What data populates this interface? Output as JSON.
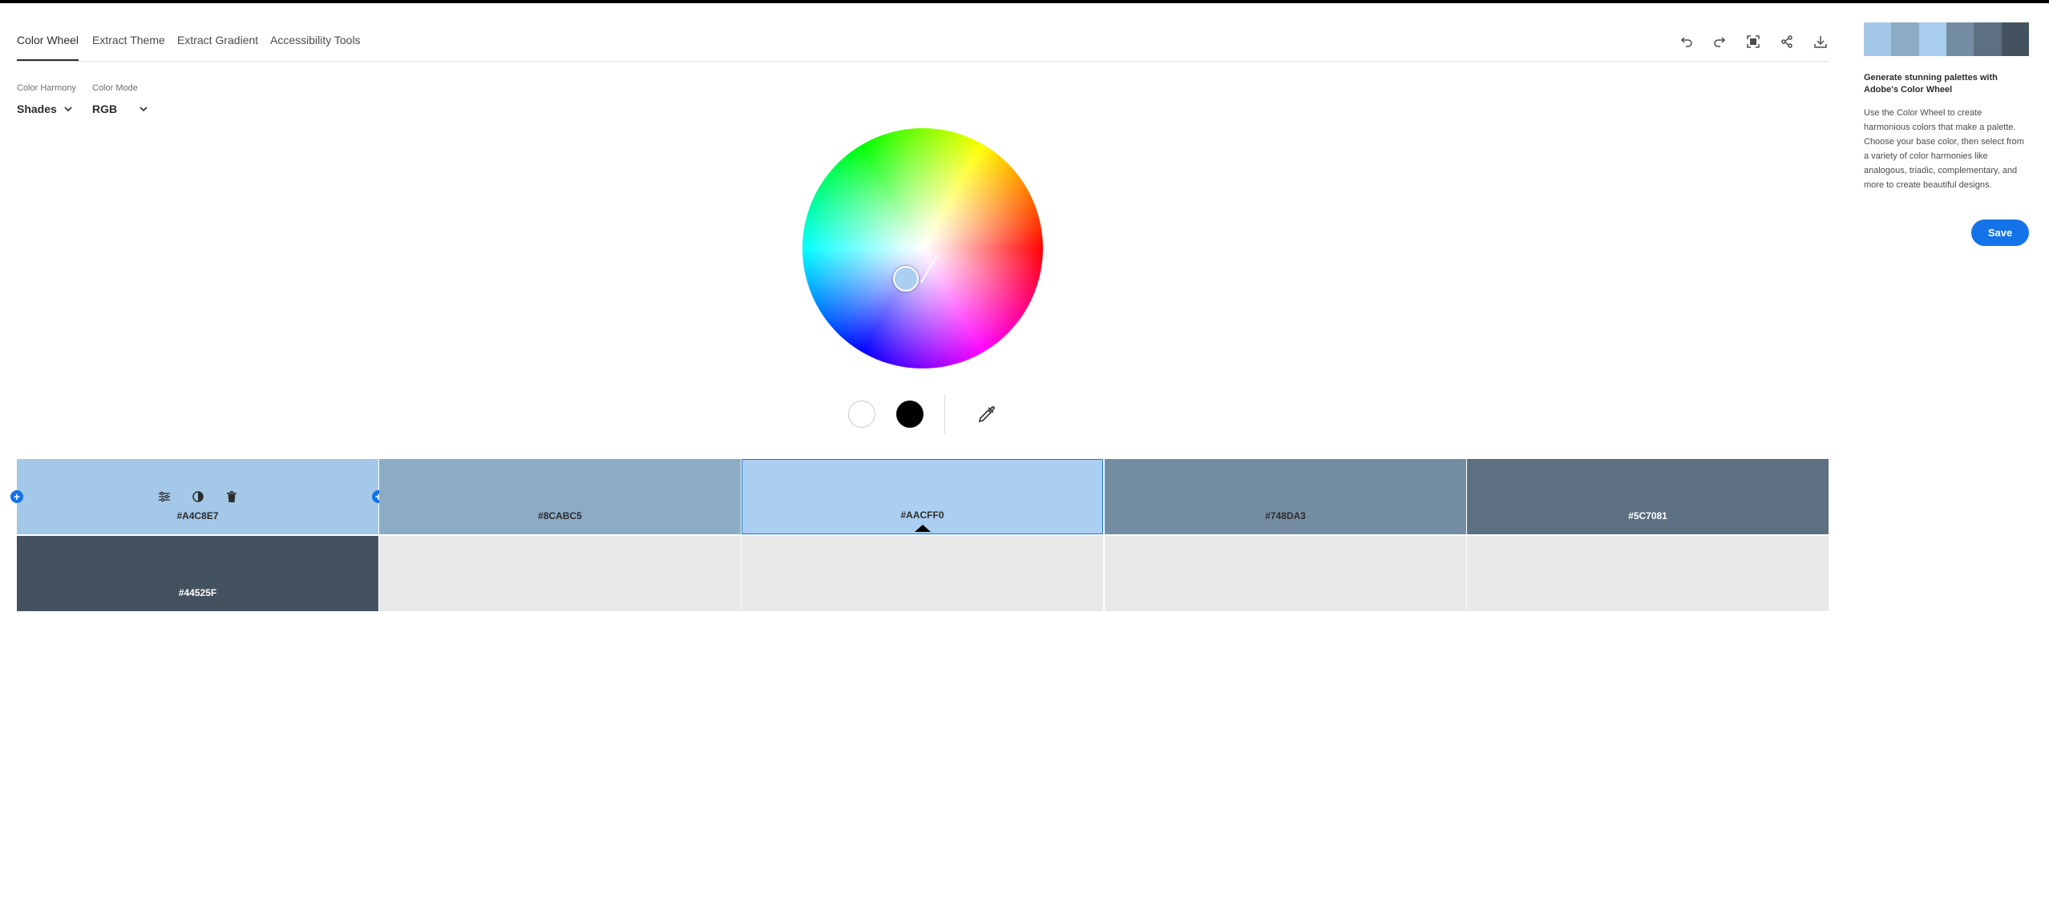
{
  "tabs": [
    {
      "label": "Color Wheel",
      "active": true
    },
    {
      "label": "Extract Theme"
    },
    {
      "label": "Extract Gradient"
    },
    {
      "label": "Accessibility Tools"
    }
  ],
  "toolbar": {
    "icons": [
      "undo-icon",
      "redo-icon",
      "fullscreen-icon",
      "share-icon",
      "download-icon"
    ]
  },
  "controls": {
    "harmony_label": "Color Harmony",
    "harmony_value": "Shades",
    "mode_label": "Color Mode",
    "mode_value": "RGB"
  },
  "wheel": {
    "base_color": "#aacff0"
  },
  "palette": [
    {
      "hex": "#A4C8E7",
      "color": "#a4c8e7",
      "text": "#2c2c2c"
    },
    {
      "hex": "#8CABC5",
      "color": "#8cabc5",
      "text": "#2c2c2c"
    },
    {
      "hex": "#AACFF0",
      "color": "#aacff0",
      "text": "#2c2c2c",
      "selected": true
    },
    {
      "hex": "#748DA3",
      "color": "#748da3",
      "text": "#2c2c2c"
    },
    {
      "hex": "#5C7081",
      "color": "#5c7081",
      "text": "#ffffff"
    },
    {
      "hex": "#44525F",
      "color": "#44525f",
      "text": "#ffffff"
    }
  ],
  "side": {
    "title": "Generate stunning palettes with Adobe's Color Wheel",
    "description": "Use the Color Wheel to create harmonious colors that make a palette. Choose your base color, then select from a variety of color harmonies like analogous, triadic, complementary, and more to create beautiful designs.",
    "save_label": "Save",
    "strip": [
      "#a4c8e7",
      "#8cabc5",
      "#aacff0",
      "#748da3",
      "#5c7081",
      "#44525f"
    ]
  },
  "colors": {
    "accent": "#1473e6"
  }
}
